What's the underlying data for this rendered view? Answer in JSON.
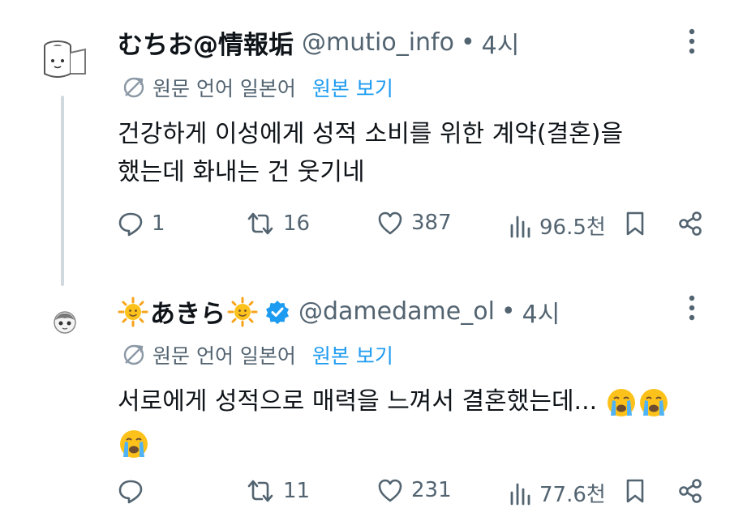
{
  "posts": [
    {
      "display_name": "むちお@情報垢",
      "handle": "@mutio_info",
      "dot": "•",
      "time": "4시",
      "translate_label": "원문 언어 일본어",
      "translate_link": "원본 보기",
      "text_line1": "건강하게 이성에게 성적 소비를 위한 계약(결혼)을",
      "text_line2": "했는데 화내는 건 웃기네",
      "replies": "1",
      "reposts": "16",
      "likes": "387",
      "views": "96.5천",
      "verified": false
    },
    {
      "display_name": "あきら",
      "handle": "@damedame_ol",
      "dot": "•",
      "time": "4시",
      "translate_label": "원문 언어 일본어",
      "translate_link": "원본 보기",
      "text_line1": "서로에게 성적으로 매력을 느껴서 결혼했는데...",
      "text_line2": "",
      "replies": "",
      "reposts": "11",
      "likes": "231",
      "views": "77.6천",
      "verified": true
    }
  ],
  "colors": {
    "text": "#0f1419",
    "secondary": "#536471",
    "link": "#1d9bf0",
    "verified": "#1d9bf0",
    "thread_line": "#cfd9de"
  },
  "icons": [
    "more-icon",
    "translate-icon",
    "reply-icon",
    "repost-icon",
    "like-icon",
    "views-icon",
    "bookmark-icon",
    "share-icon",
    "sun-emoji",
    "crying-emoji",
    "verified-badge-icon"
  ]
}
